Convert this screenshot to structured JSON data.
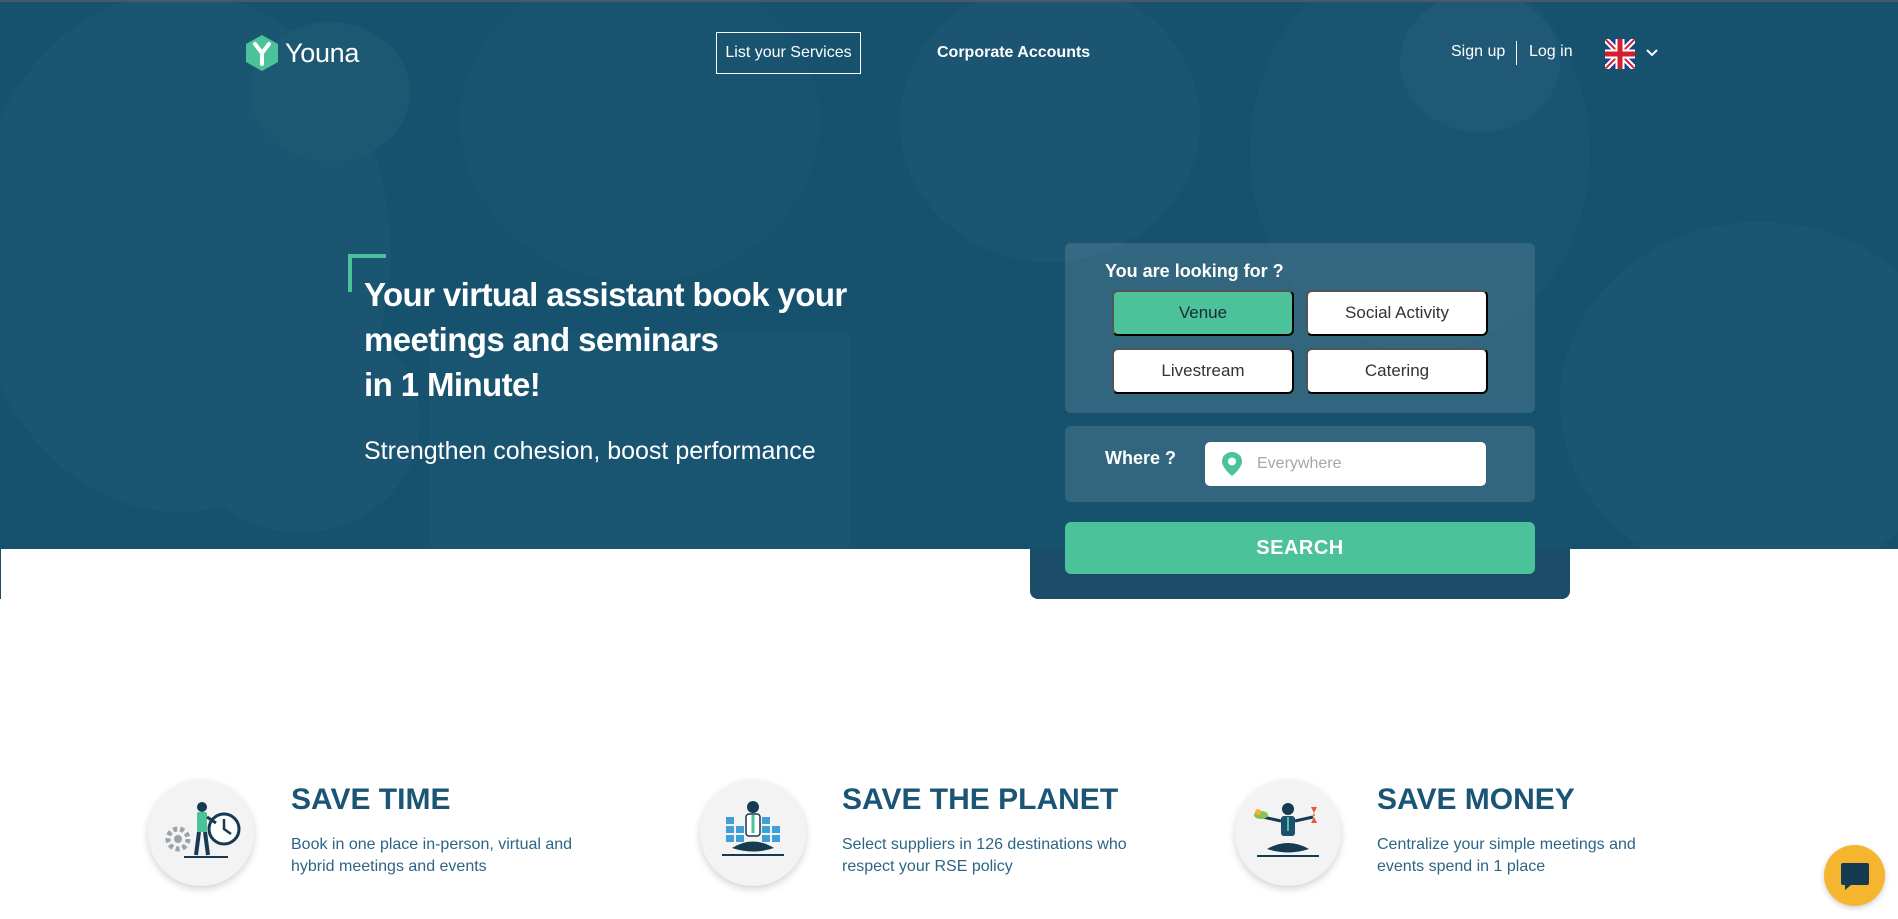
{
  "brand": {
    "name": "Youna",
    "accent": "#4bc29a",
    "primary": "#1a5576",
    "chat_color": "#f5b52e"
  },
  "nav": {
    "list_services": "List your Services",
    "corporate": "Corporate Accounts",
    "signup": "Sign up",
    "login": "Log in",
    "language_icon": "uk-flag-icon"
  },
  "hero": {
    "headline_1": "Your virtual assistant book your",
    "headline_2": "meetings and seminars",
    "headline_3": "in 1 Minute!",
    "subline": "Strengthen cohesion, boost performance"
  },
  "search": {
    "looking_for_label": "You are looking for ?",
    "types": [
      {
        "label": "Venue",
        "selected": true
      },
      {
        "label": "Social Activity",
        "selected": false
      },
      {
        "label": "Livestream",
        "selected": false
      },
      {
        "label": "Catering",
        "selected": false
      }
    ],
    "where_label": "Where ?",
    "where_placeholder": "Everywhere",
    "where_value": "",
    "button": "SEARCH"
  },
  "features": [
    {
      "title": "SAVE TIME",
      "desc_1": "Book in one place in-person, virtual and",
      "desc_2": "hybrid meetings and events",
      "icon": "clock-person-icon"
    },
    {
      "title": "SAVE THE PLANET",
      "desc_1": "Select suppliers in 126 destinations who",
      "desc_2": "respect your RSE policy",
      "icon": "meditating-person-icon"
    },
    {
      "title": "SAVE MONEY",
      "desc_1": "Centralize your simple meetings and",
      "desc_2": "events spend in 1 place",
      "icon": "balance-person-icon"
    }
  ],
  "chat": {
    "icon": "chat-bubble-icon"
  }
}
